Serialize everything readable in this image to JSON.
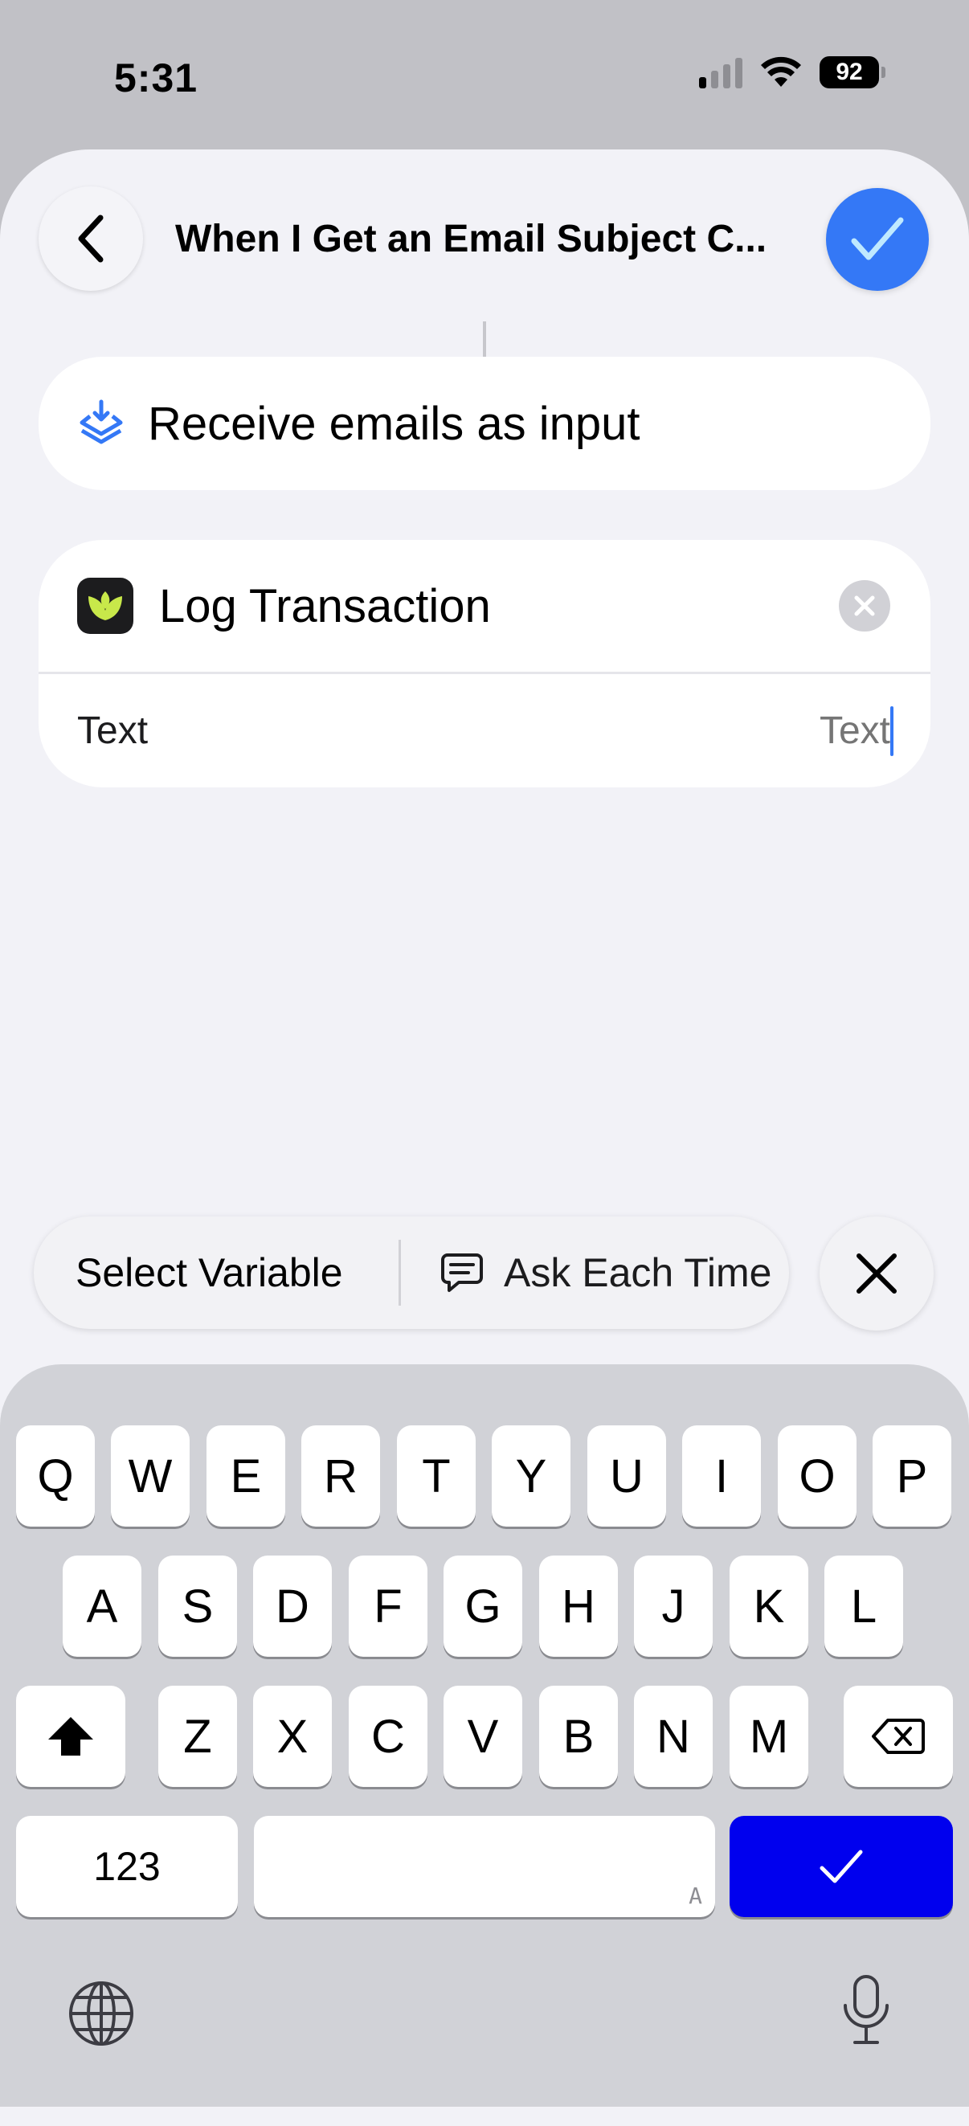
{
  "status_bar": {
    "time": "5:31",
    "battery": "92"
  },
  "header": {
    "title": "When I Get an Email Subject C..."
  },
  "input_card": {
    "label": "Receive emails as input"
  },
  "action_card": {
    "title": "Log Transaction",
    "param_label": "Text",
    "param_placeholder": "Text"
  },
  "variable_bar": {
    "select_variable": "Select Variable",
    "ask_each_time": "Ask Each Time"
  },
  "keyboard": {
    "row1": [
      "Q",
      "W",
      "E",
      "R",
      "T",
      "Y",
      "U",
      "I",
      "O",
      "P"
    ],
    "row2": [
      "A",
      "S",
      "D",
      "F",
      "G",
      "H",
      "J",
      "K",
      "L"
    ],
    "row3": [
      "Z",
      "X",
      "C",
      "V",
      "B",
      "N",
      "M"
    ],
    "numbers_key": "123",
    "space_hint": "A"
  },
  "colors": {
    "accent": "#3478f6",
    "return_key": "#0000ee",
    "sheet_bg": "#f2f2f7",
    "keyboard_bg": "#d1d2d7"
  }
}
